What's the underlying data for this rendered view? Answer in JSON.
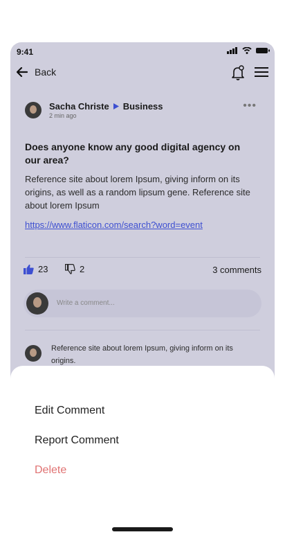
{
  "status_bar": {
    "time": "9:41"
  },
  "header": {
    "back_label": "Back"
  },
  "post": {
    "author": "Sacha Christe",
    "category": "Business",
    "time_ago": "2 min ago",
    "title": "Does anyone know any good digital agency on our area?",
    "body": "Reference site about lorem Ipsum, giving inform on its origins, as well as a random lipsum gene. Reference site about lorem Ipsum",
    "link": "https://www.flaticon.com/search?word=event",
    "likes": "23",
    "dislikes": "2",
    "comments_label": "3 comments"
  },
  "comment_input": {
    "placeholder": "Write a comment..."
  },
  "comments": [
    {
      "text": "Reference site about lorem Ipsum, giving inform on its origins."
    }
  ],
  "action_sheet": {
    "items": [
      {
        "label": "Edit Comment"
      },
      {
        "label": "Report Comment"
      },
      {
        "label": "Delete"
      }
    ]
  },
  "colors": {
    "accent": "#3d4fd1",
    "danger": "#e07272",
    "overlay": "#cfcedd"
  }
}
